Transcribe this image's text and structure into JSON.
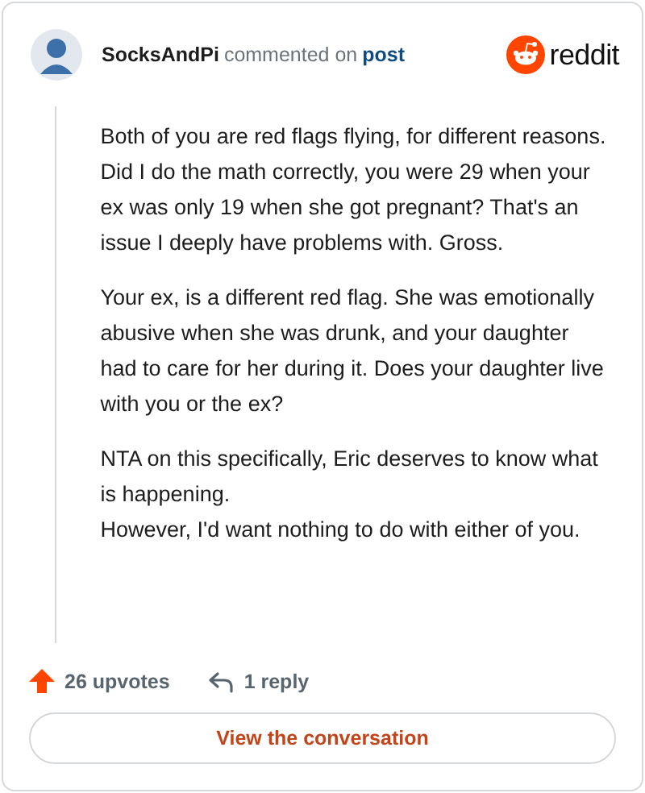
{
  "header": {
    "username": "SocksAndPi",
    "action": "commented on",
    "link": "post",
    "brand": "reddit"
  },
  "comment": {
    "paragraphs": [
      "Both of you are red flags flying, for different reasons. Did I do the math correctly, you were 29 when your ex was only 19 when she got pregnant? That's an issue I deeply have problems with. Gross.",
      "Your ex, is a different red flag. She was emotionally abusive when she was drunk, and your daughter had to care for her during it. Does your daughter live with you or the ex?",
      "NTA on this specifically, Eric deserves to know what is happening.\nHowever, I'd want nothing to do with either of you."
    ]
  },
  "footer": {
    "upvotes": "26 upvotes",
    "replies": "1 reply"
  },
  "button": {
    "label": "View the conversation"
  }
}
